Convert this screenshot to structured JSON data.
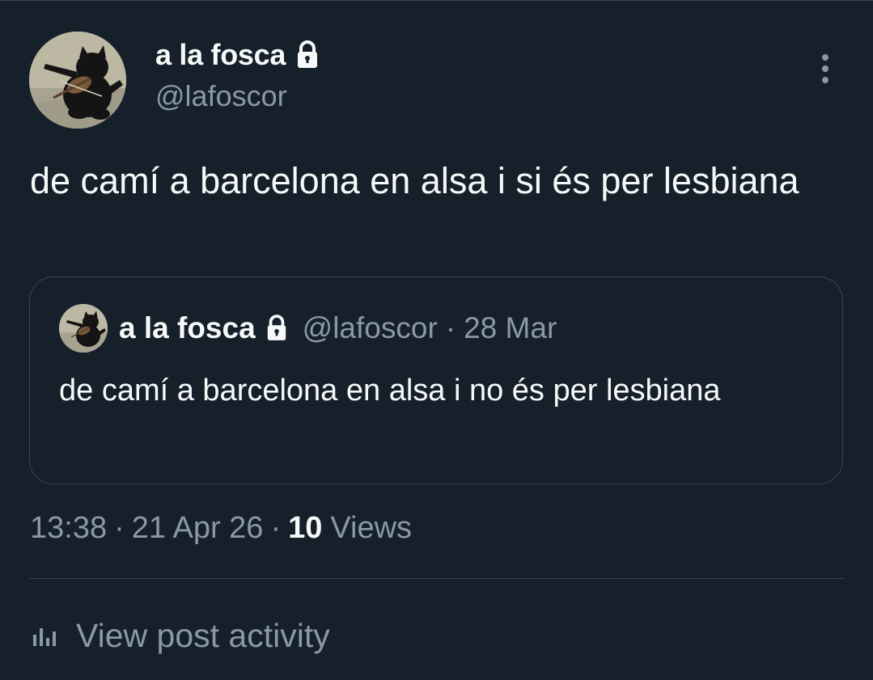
{
  "post": {
    "author": {
      "display_name": "a la fosca",
      "handle": "@lafoscor",
      "avatar": "black-cat-playing-violin",
      "protected_icon": "lock-icon"
    },
    "more_icon": "more-vertical-icon",
    "text": "de camí a barcelona en alsa i si és per lesbiana",
    "quoted": {
      "display_name": "a la fosca",
      "handle": "@lafoscor",
      "separator": "·",
      "date": "28 Mar",
      "text": "de camí a barcelona en alsa i no és per lesbiana",
      "protected_icon": "lock-icon"
    },
    "meta": {
      "time": "13:38",
      "separator": "·",
      "date": "21 Apr 26",
      "views_count": "10",
      "views_label": "Views"
    },
    "activity": {
      "icon": "bar-chart-icon",
      "label": "View post activity"
    }
  },
  "colors": {
    "background": "#15202b",
    "primary_text": "#f7f9f9",
    "secondary_text": "#8b98a5",
    "border": "#38444d"
  }
}
